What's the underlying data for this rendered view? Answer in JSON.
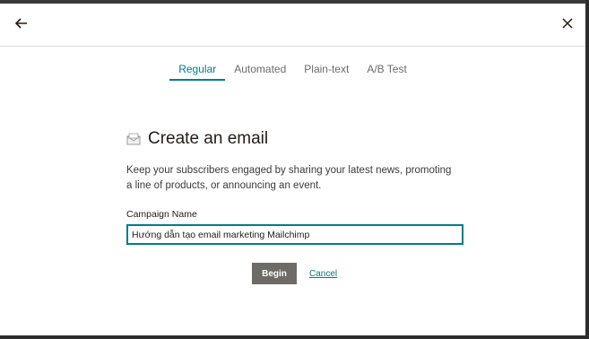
{
  "header": {
    "back_icon": "arrow-left-icon",
    "close_icon": "close-icon"
  },
  "tabs": [
    {
      "label": "Regular",
      "active": true
    },
    {
      "label": "Automated",
      "active": false
    },
    {
      "label": "Plain-text",
      "active": false
    },
    {
      "label": "A/B Test",
      "active": false
    }
  ],
  "main": {
    "icon": "envelope-icon",
    "title": "Create an email",
    "description": "Keep your subscribers engaged by sharing your latest news, promoting a line of products, or announcing an event.",
    "field_label": "Campaign Name",
    "campaign_name_value": "Hướng dẫn tạo email marketing Mailchimp"
  },
  "actions": {
    "begin_label": "Begin",
    "cancel_label": "Cancel"
  },
  "colors": {
    "accent": "#007c89",
    "button": "#6e6a66",
    "text": "#241c15"
  }
}
